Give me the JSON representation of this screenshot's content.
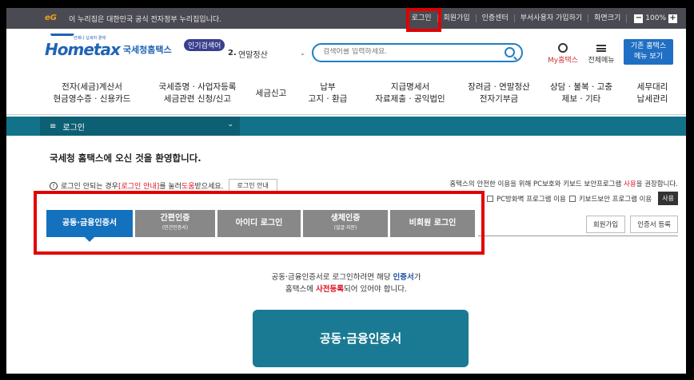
{
  "gov_bar": {
    "logo": "eG",
    "text": "이 누리집은 대한민국 공식 전자정부 누리집입니다.",
    "links": [
      "로그인",
      "회원가입",
      "인증센터",
      "부서사용자 가입하기",
      "화면크기"
    ],
    "zoom_minus": "−",
    "zoom_value": "100%",
    "zoom_plus": "+"
  },
  "header": {
    "logo_text": "Hometax",
    "logo_kr": "국세청홈택스",
    "logo_small": "언제나 납세자 곁에",
    "search_tag": "인기검색어",
    "search_num": "2.",
    "search_select": "연말정산",
    "search_caret": "⌄",
    "search_placeholder": "검색어를 입력하세요.",
    "my_label": "My홈택스",
    "menu_label": "전체메뉴",
    "old_button_l1": "기존 홈택스",
    "old_button_l2": "메뉴 보기"
  },
  "nav": [
    {
      "l1": "전자(세금)계산서",
      "l2": "현금영수증 · 신용카드"
    },
    {
      "l1": "국세증명 · 사업자등록",
      "l2": "세금관련 신청/신고"
    },
    {
      "l1": "세금신고",
      "l2": ""
    },
    {
      "l1": "납부",
      "l2": "고지 · 환급"
    },
    {
      "l1": "지급명세서",
      "l2": "자료제출 · 공익법인"
    },
    {
      "l1": "장려금 · 연말정산",
      "l2": "전자기부금"
    },
    {
      "l1": "상담 · 불복 · 고충",
      "l2": "제보 · 기타"
    },
    {
      "l1": "세무대리",
      "l2": "납세관리"
    }
  ],
  "breadcrumb": {
    "label": "로그인",
    "menu_glyph": "≡",
    "caret": "⌄"
  },
  "content": {
    "welcome": "국세청 홈택스에 오신 것을 환영합니다.",
    "help_icon": "!",
    "help_a": "로그인 안되는 경우 ",
    "help_b": "[로그인 안내]",
    "help_c": "를 눌러 ",
    "help_d": "도움",
    "help_e": "받으세요.",
    "help_btn": "로그인 안내",
    "sec_a": "홈택스의 안전한 이용을 위해 PC보호와 키보드 보안프로그램 ",
    "sec_b": "사용",
    "sec_c": "을 권장합니다.",
    "sec_opt1": "PC방화벽 프로그램 이용",
    "sec_opt2": "키보드보안 프로그램 이용",
    "sec_use": "사용",
    "tabs": [
      {
        "label": "공동·금융인증서",
        "sub": "",
        "active": true
      },
      {
        "label": "간편인증",
        "sub": "(민간인증서)",
        "active": false
      },
      {
        "label": "아이디 로그인",
        "sub": "",
        "active": false
      },
      {
        "label": "생체인증",
        "sub": "(얼굴·지문)",
        "active": false
      },
      {
        "label": "비회원 로그인",
        "sub": "",
        "active": false
      }
    ],
    "join_btn": "회원가입",
    "cert_reg_btn": "인증서 등록",
    "desc1_a": "공동·금융인증서로 로그인하려면 해당 ",
    "desc1_b": "인증서",
    "desc1_c": "가",
    "desc2_a": "홈택스에 ",
    "desc2_b": "사전등록",
    "desc2_c": "되어 있어야 합니다.",
    "cert_button": "공동·금융인증서"
  },
  "colors": {
    "highlight": "#e10000",
    "primary": "#1471bd",
    "teal": "#12728a"
  }
}
